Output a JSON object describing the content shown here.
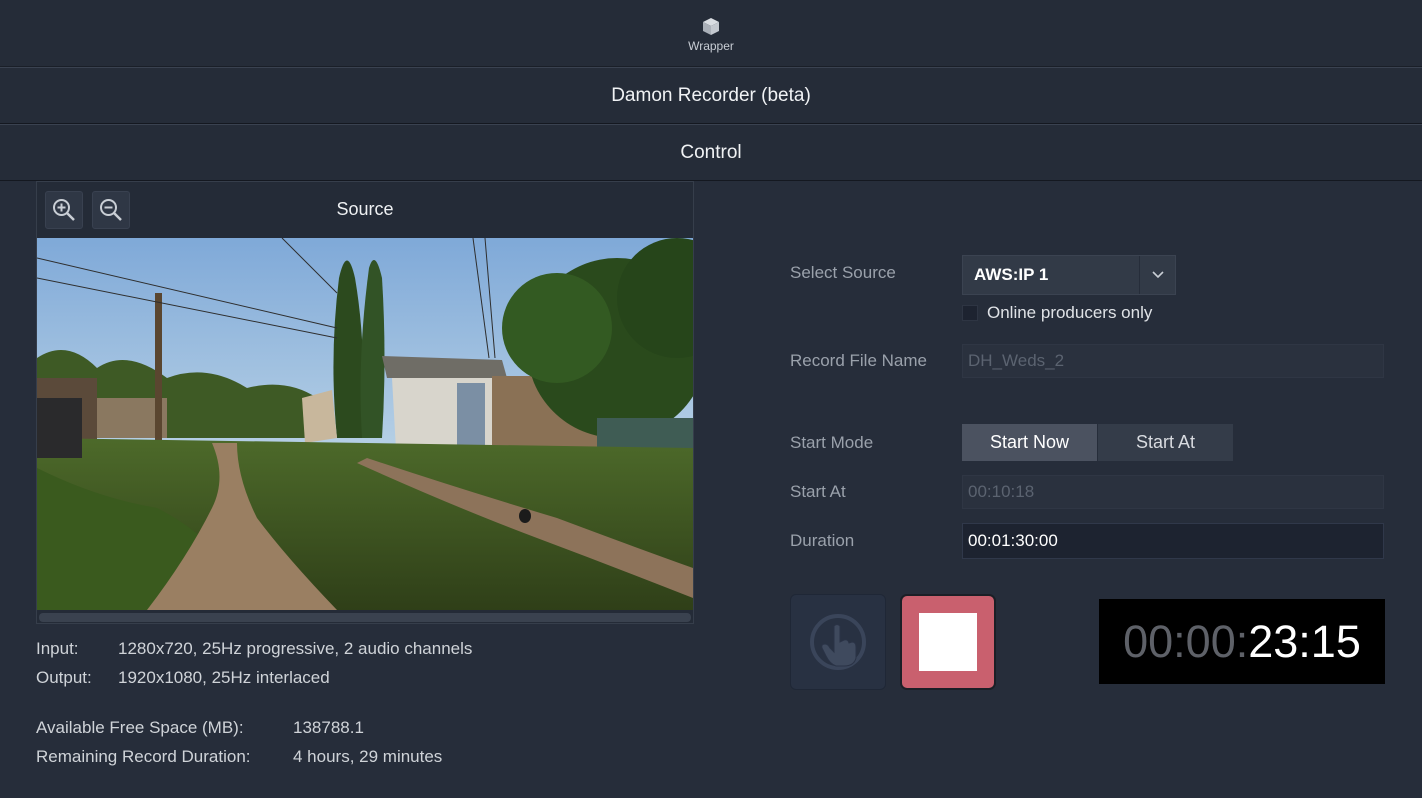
{
  "top": {
    "app_label": "Wrapper"
  },
  "bars": {
    "title": "Damon Recorder (beta)",
    "section": "Control"
  },
  "source": {
    "title": "Source",
    "info": {
      "input_label": "Input:",
      "input_value": "1280x720, 25Hz progressive, 2 audio channels",
      "output_label": "Output:",
      "output_value": "1920x1080, 25Hz interlaced",
      "free_space_label": "Available Free Space (MB):",
      "free_space_value": "138788.1",
      "remaining_label": "Remaining Record Duration:",
      "remaining_value": "4 hours, 29 minutes"
    }
  },
  "form": {
    "select_source_label": "Select Source",
    "select_source_value": "AWS:IP 1",
    "online_only_label": "Online producers only",
    "record_file_label": "Record File Name",
    "record_file_placeholder": "DH_Weds_2",
    "start_mode_label": "Start Mode",
    "start_now_label": "Start Now",
    "start_at_button_label": "Start At",
    "start_at_label": "Start At",
    "start_at_value": "00:10:18",
    "duration_label": "Duration",
    "duration_value": "00:01:30:00"
  },
  "timer": {
    "dim_part": "00:00:",
    "bright_part": "23:15"
  },
  "colors": {
    "stop_button": "#c9606e",
    "background": "#262d3a",
    "timer_bg": "#000000"
  }
}
